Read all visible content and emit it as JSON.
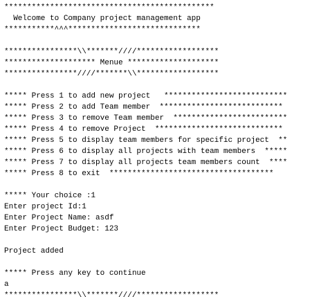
{
  "console": {
    "header": {
      "top_border": "**********************************************",
      "welcome": "  Welcome to Company project management app",
      "bottom_border": "***********^^^*****************************"
    },
    "menu": {
      "top_border": "****************\\\\*******////******************",
      "title": "******************** Menue ********************",
      "bottom_border": "****************////*******\\\\******************"
    },
    "options": [
      "***** Press 1 to add new project   ***************************",
      "***** Press 2 to add Team member  ***************************",
      "***** Press 3 to remove Team member  *************************",
      "***** Press 4 to remove Project  ****************************",
      "***** Press 5 to display team members for specific project  **",
      "***** Press 6 to display all projects with team members  *****",
      "***** Press 7 to display all projects team members count  ****",
      "***** Press 8 to exit  ************************************"
    ],
    "session": {
      "choice_prompt": "***** Your choice :1",
      "project_id": "Enter project Id:1",
      "project_name": "Enter Project Name: asdf",
      "project_budget": "Enter Project Budget: 123",
      "result": "Project added",
      "continue_prompt": "***** Press any key to continue",
      "user_key": "a",
      "partial_border": "****************\\\\*******////******************"
    }
  }
}
